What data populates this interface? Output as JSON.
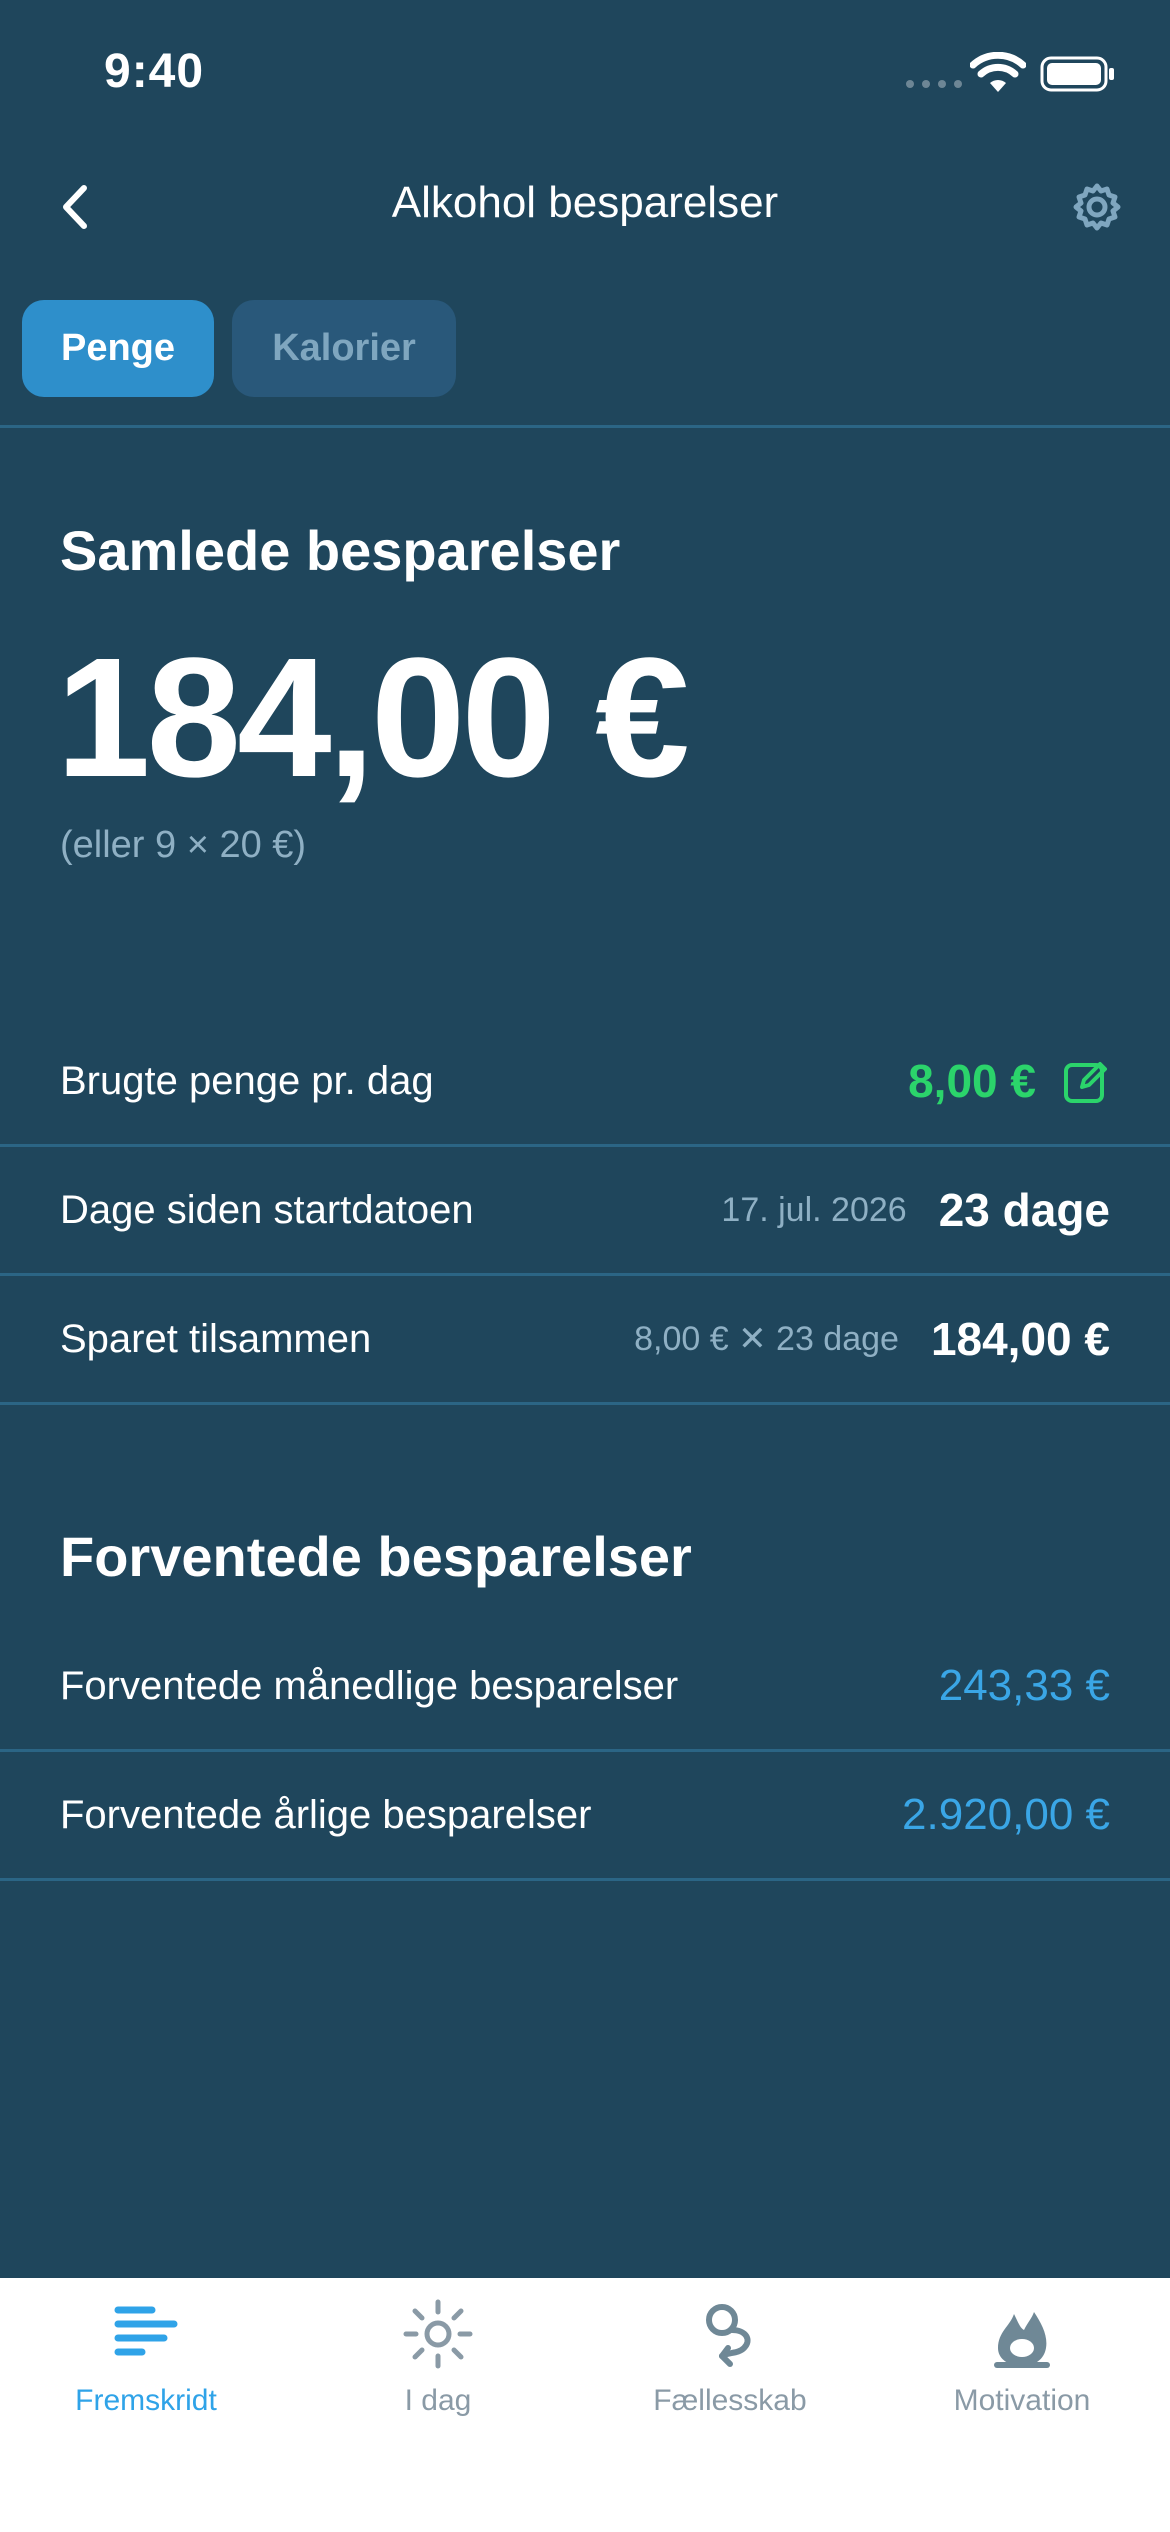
{
  "status_bar": {
    "time": "9:40"
  },
  "nav": {
    "title": "Alkohol besparelser"
  },
  "segments": {
    "active": "Penge",
    "inactive": "Kalorier"
  },
  "summary": {
    "title": "Samlede besparelser",
    "total": "184,00 €",
    "note": "(eller 9 × 20 €)"
  },
  "rows": [
    {
      "label": "Brugte penge pr. dag",
      "value": "8,00 €"
    },
    {
      "label": "Dage siden startdatoen",
      "sub": "17. jul. 2026",
      "value": "23 dage"
    },
    {
      "label": "Sparet tilsammen",
      "sub": "8,00 € ✕ 23 dage",
      "value": "184,00 €"
    }
  ],
  "expected": {
    "title": "Forventede besparelser",
    "monthly_label": "Forventede månedlige besparelser",
    "monthly_value": "243,33 €",
    "yearly_label": "Forventede årlige besparelser",
    "yearly_value": "2.920,00 €"
  },
  "tabs": [
    {
      "label": "Fremskridt",
      "icon": "progress-bars-icon"
    },
    {
      "label": "I dag",
      "icon": "sun-icon"
    },
    {
      "label": "Fællesskab",
      "icon": "community-icon"
    },
    {
      "label": "Motivation",
      "icon": "flame-icon"
    }
  ],
  "colors": {
    "background": "#1f465c",
    "accent_blue": "#2e8fcb",
    "green": "#2bd46b",
    "value_blue": "#3aa6e6",
    "tab_active": "#2fa3e8"
  }
}
